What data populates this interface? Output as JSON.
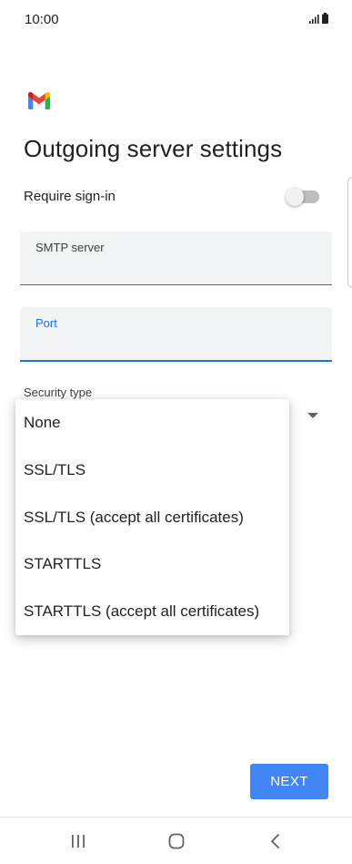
{
  "status_bar": {
    "time": "10:00",
    "icons": [
      "signal-icon",
      "battery-icon"
    ]
  },
  "app": {
    "logo": "gmail-logo-icon",
    "brand_colors": [
      "#ea4335",
      "#4285f4",
      "#34a853",
      "#fbbc04",
      "#c5221f"
    ]
  },
  "page": {
    "title": "Outgoing server settings"
  },
  "require_signin": {
    "label": "Require sign-in",
    "checked": false
  },
  "smtp_field": {
    "label": "SMTP server",
    "value": ""
  },
  "port_field": {
    "label": "Port",
    "value": "",
    "focused": true
  },
  "security": {
    "label": "Security type",
    "options": [
      "None",
      "SSL/TLS",
      "SSL/TLS (accept all certificates)",
      "STARTTLS",
      "STARTTLS (accept all certificates)"
    ]
  },
  "actions": {
    "next_label": "NEXT"
  },
  "nav_bar": {
    "buttons": [
      "recent-apps-icon",
      "home-icon",
      "back-icon"
    ]
  },
  "colors": {
    "accent": "#1a73e8",
    "button": "#4285f4",
    "field_bg": "#f1f3f4"
  }
}
